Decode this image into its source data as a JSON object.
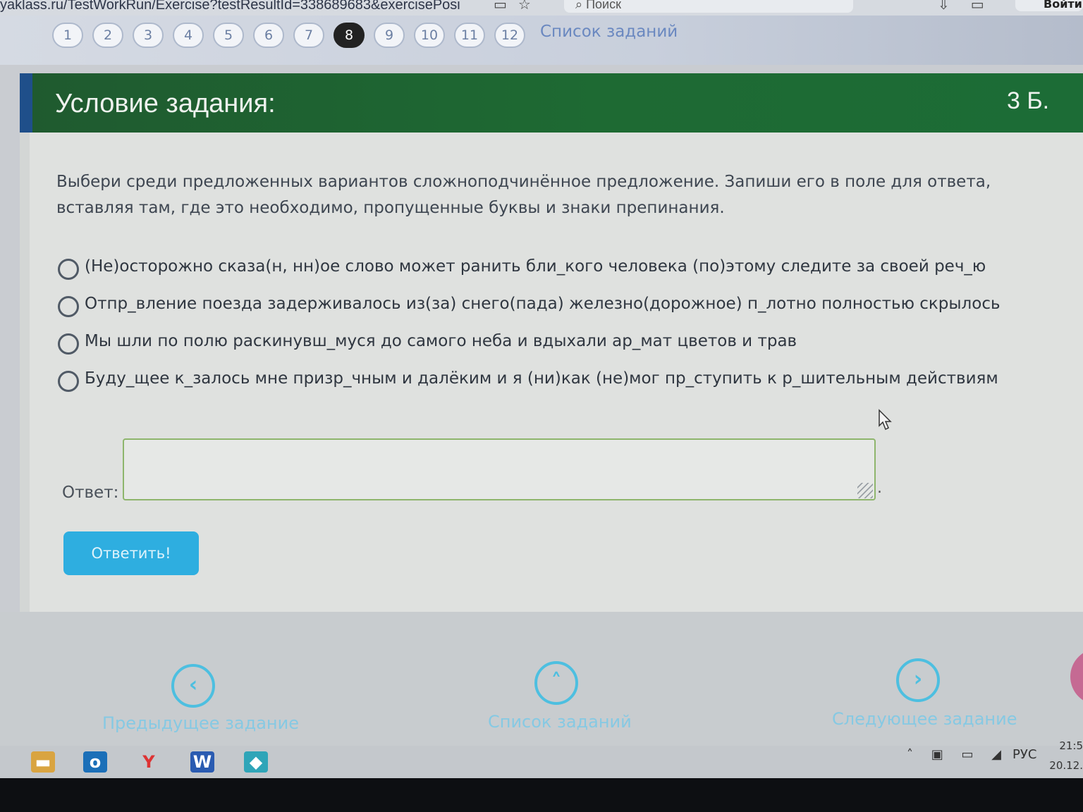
{
  "browser": {
    "url": "yaklass.ru/TestWorkRun/Exercise?testResultId=338689683&exercisePosi",
    "search_placeholder": "Поиск",
    "login_label": "Войти"
  },
  "task_numbers": [
    "1",
    "2",
    "3",
    "4",
    "5",
    "6",
    "7",
    "8",
    "9",
    "10",
    "11",
    "12"
  ],
  "active_task": "8",
  "task_list_link": "Список заданий",
  "header": {
    "title": "Условие задания:",
    "points": "3 Б."
  },
  "instructions": "Выбери среди предложенных вариантов сложноподчинённое предложение. Запиши его в поле для ответа, вставляя там, где это необходимо, пропущенные буквы и знаки препинания.",
  "options": [
    "(Не)осторожно сказа(н, нн)ое слово может ранить бли_кого человека (по)этому следите за своей реч_ю",
    "Отпр_вление поезда задерживалось из(за) снего(пада) железно(дорожное) п_лотно полностью скрылось",
    "Мы шли по полю раскинувш_муся до самого неба и вдыхали ар_мат цветов и трав",
    "Буду_щее к_залось мне призр_чным и далёким и я (ни)как (не)мог пр_ступить к р_шительным действиям"
  ],
  "answer": {
    "label": "Ответ:",
    "value": "",
    "trailing": "."
  },
  "submit_label": "Ответить!",
  "bottom_nav": {
    "prev_label": "Предыдущее задание",
    "list_label": "Список заданий",
    "next_label": "Следующее задание"
  },
  "taskbar": {
    "lang": "РУС",
    "time": "21:5",
    "date": "20.12."
  },
  "colors": {
    "header_green": "#1e6a33",
    "accent_blue": "#2eaee0",
    "nav_blue": "#4dbfe0"
  }
}
